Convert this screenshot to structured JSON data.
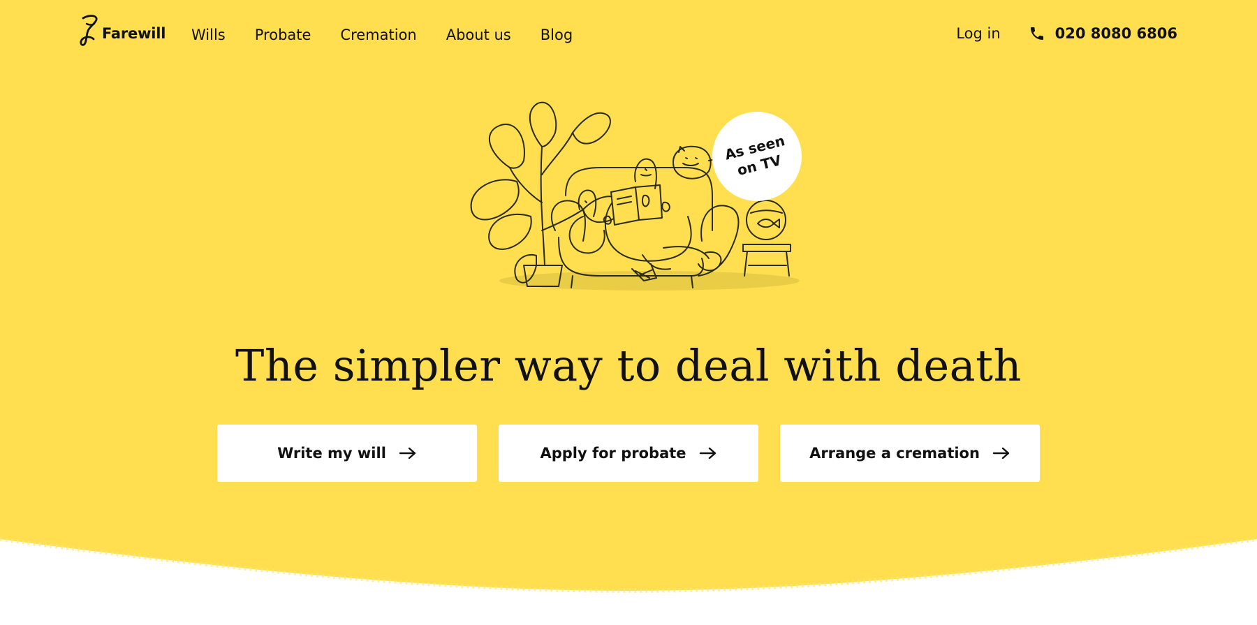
{
  "colors": {
    "brand_yellow": "#FFDF4F",
    "text": "#111111",
    "button_bg": "#FFFFFF",
    "page_bg": "#FFFFFF"
  },
  "header": {
    "logo_icon": "farewill-swirl-logo-icon",
    "logo_text": "Farewill",
    "nav_items": [
      {
        "label": "Wills"
      },
      {
        "label": "Probate"
      },
      {
        "label": "Cremation"
      },
      {
        "label": "About us"
      },
      {
        "label": "Blog"
      }
    ],
    "login_label": "Log in",
    "phone_icon": "phone-icon",
    "phone_number": "020 8080 6806"
  },
  "hero": {
    "illustration_icon": "family-on-sofa-illustration",
    "badge": {
      "line1": "As seen",
      "line2": "on TV"
    },
    "headline": "The simpler way to deal with death",
    "cta_arrow_icon": "arrow-right-icon",
    "ctas": [
      {
        "label": "Write my will"
      },
      {
        "label": "Apply for probate"
      },
      {
        "label": "Arrange a cremation"
      }
    ]
  }
}
